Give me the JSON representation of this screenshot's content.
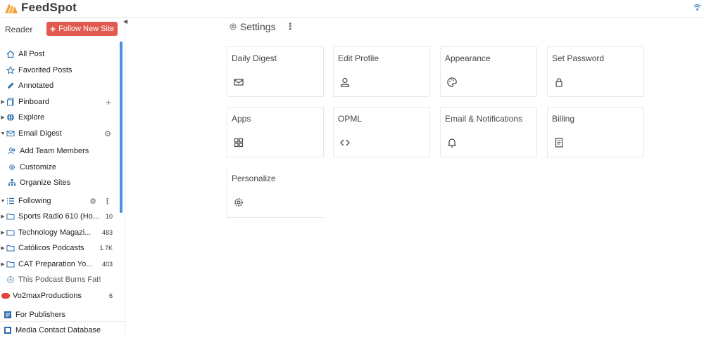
{
  "app": {
    "name": "FeedSpot"
  },
  "sidebar": {
    "reader_label": "Reader",
    "follow_button": "Follow New Site",
    "items": [
      {
        "label": "All Post",
        "icon": "home-icon"
      },
      {
        "label": "Favorited Posts",
        "icon": "star-icon"
      },
      {
        "label": "Annotated",
        "icon": "pencil-icon"
      },
      {
        "label": "Pinboard",
        "icon": "pinboard-icon"
      },
      {
        "label": "Explore",
        "icon": "globe-icon"
      },
      {
        "label": "Email Digest",
        "icon": "mail-icon"
      },
      {
        "label": "Add Team Members",
        "icon": "team-icon"
      },
      {
        "label": "Customize",
        "icon": "gear-icon"
      },
      {
        "label": "Organize Sites",
        "icon": "sitemap-icon"
      },
      {
        "label": "Following",
        "icon": "list-icon"
      }
    ],
    "folders": [
      {
        "label": "Sports Radio 610 (Ho...",
        "count": "10"
      },
      {
        "label": "Technology Magazi...",
        "count": "483"
      },
      {
        "label": "Católicos Podcasts",
        "count": "1.7K"
      },
      {
        "label": "CAT Preparation Yo...",
        "count": "403"
      }
    ],
    "feeds": [
      {
        "label": "This Podcast Burns Fat!",
        "count": ""
      },
      {
        "label": "Vo2maxProductions",
        "count": "6"
      }
    ],
    "bottom": [
      {
        "label": "For Publishers"
      },
      {
        "label": "Media Contact Database"
      }
    ]
  },
  "settings": {
    "title": "Settings",
    "cards": [
      {
        "label": "Daily Digest",
        "icon": "envelope-icon"
      },
      {
        "label": "Edit Profile",
        "icon": "user-icon"
      },
      {
        "label": "Appearance",
        "icon": "palette-icon"
      },
      {
        "label": "Set Password",
        "icon": "lock-icon"
      },
      {
        "label": "Apps",
        "icon": "grid-icon"
      },
      {
        "label": "OPML",
        "icon": "code-icon"
      },
      {
        "label": "Email & Notifications",
        "icon": "bell-icon"
      },
      {
        "label": "Billing",
        "icon": "document-icon"
      },
      {
        "label": "Personalize",
        "icon": "gear-icon"
      }
    ]
  },
  "colors": {
    "accent": "#e25a4f",
    "link_blue": "#2b6cb0",
    "scroll": "#4a90e2"
  }
}
